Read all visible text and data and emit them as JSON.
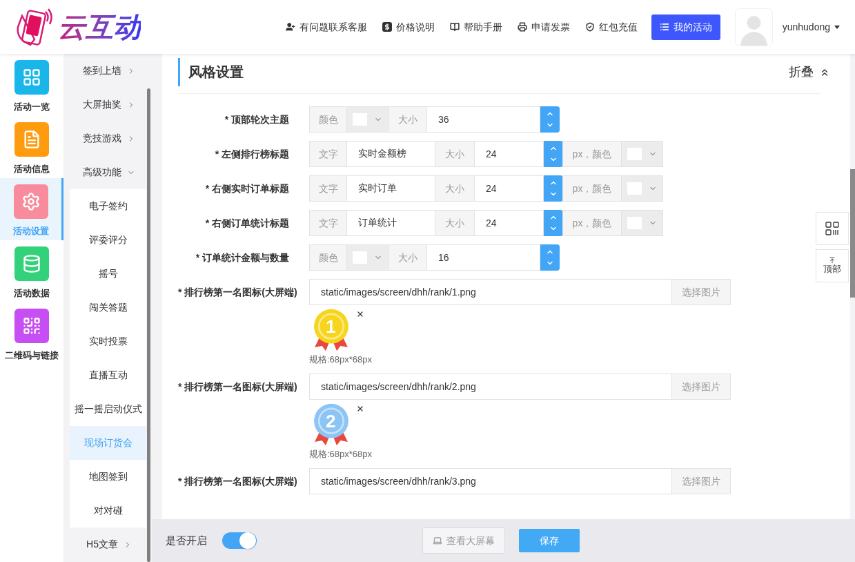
{
  "header": {
    "logo_text": "云互动",
    "links": [
      {
        "label": "有问题联系客服"
      },
      {
        "label": "价格说明"
      },
      {
        "label": "帮助手册"
      },
      {
        "label": "申请发票"
      },
      {
        "label": "红包充值"
      }
    ],
    "primary_button": "我的活动",
    "username": "yunhudong"
  },
  "nav": [
    {
      "label": "活动一览",
      "color": "#19b6ea",
      "selected": false
    },
    {
      "label": "活动信息",
      "color": "#ff9b0f",
      "selected": false
    },
    {
      "label": "活动设置",
      "color": "#f98c9c",
      "selected": true
    },
    {
      "label": "活动数据",
      "color": "#33d17a",
      "selected": false
    },
    {
      "label": "二维码与链接",
      "color": "#c74ef2",
      "selected": false
    }
  ],
  "submenu": [
    {
      "label": "签到上墙",
      "expanded": false
    },
    {
      "label": "大屏抽奖",
      "expanded": false
    },
    {
      "label": "竞技游戏",
      "expanded": false
    },
    {
      "label": "高级功能",
      "expanded": true,
      "children": [
        {
          "label": "电子签约",
          "selected": false
        },
        {
          "label": "评委评分",
          "selected": false
        },
        {
          "label": "摇号",
          "selected": false
        },
        {
          "label": "闯关答题",
          "selected": false
        },
        {
          "label": "实时投票",
          "selected": false
        },
        {
          "label": "直播互动",
          "selected": false
        },
        {
          "label": "摇一摇启动仪式",
          "selected": false
        },
        {
          "label": "现场订货会",
          "selected": true
        },
        {
          "label": "地图签到",
          "selected": false
        },
        {
          "label": "对对碰",
          "selected": false
        }
      ]
    },
    {
      "label": "H5文章",
      "expanded": false
    }
  ],
  "section": {
    "title": "风格设置",
    "collapse_label": "折叠"
  },
  "rows": [
    {
      "kind": "color_size",
      "label": "* 顶部轮次主题",
      "color_addon": "颜色",
      "size_addon": "大小",
      "size": "36"
    },
    {
      "kind": "text_size_color",
      "label": "* 左侧排行榜标题",
      "text_addon": "文字",
      "text": "实时金额榜",
      "size_addon": "大小",
      "size": "24",
      "unit_addon": "px，颜色"
    },
    {
      "kind": "text_size_color",
      "label": "* 右侧实时订单标题",
      "text_addon": "文字",
      "text": "实时订单",
      "size_addon": "大小",
      "size": "24",
      "unit_addon": "px，颜色"
    },
    {
      "kind": "text_size_color",
      "label": "* 右侧订单统计标题",
      "text_addon": "文字",
      "text": "订单统计",
      "size_addon": "大小",
      "size": "24",
      "unit_addon": "px，颜色"
    },
    {
      "kind": "color_size",
      "label": "* 订单统计金额与数量",
      "color_addon": "颜色",
      "size_addon": "大小",
      "size": "16"
    },
    {
      "kind": "image",
      "label": "* 排行榜第一名图标(大屏端)",
      "path": "static/images/screen/dhh/rank/1.png",
      "button": "选择图片",
      "preview": {
        "number": "1",
        "color": "#f7d51d"
      },
      "note": "规格:68px*68px"
    },
    {
      "kind": "image",
      "label": "* 排行榜第一名图标(大屏端)",
      "path": "static/images/screen/dhh/rank/2.png",
      "button": "选择图片",
      "preview": {
        "number": "2",
        "color": "#8cc4f5"
      },
      "note": "规格:68px*68px"
    },
    {
      "kind": "image",
      "label": "* 排行榜第一名图标(大屏端)",
      "path": "static/images/screen/dhh/rank/3.png",
      "button": "选择图片"
    }
  ],
  "footer": {
    "toggle_label": "是否开启",
    "toggle_on": true,
    "view_button": "查看大屏幕",
    "save_button": "保存"
  },
  "floating": {
    "top_label": "顶部"
  }
}
